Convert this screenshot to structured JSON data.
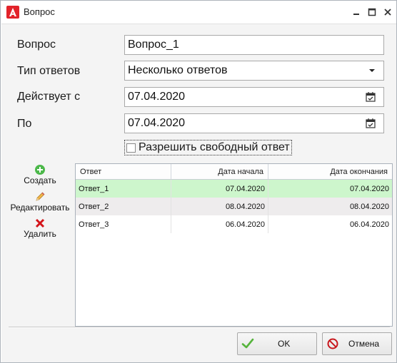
{
  "window": {
    "title": "Вопрос",
    "icon": "app-logo-icon"
  },
  "form": {
    "question_label": "Вопрос",
    "question_value": "Вопрос_1",
    "answer_type_label": "Тип ответов",
    "answer_type_value": "Несколько ответов",
    "valid_from_label": "Действует с",
    "valid_from_value": "07.04.2020",
    "valid_to_label": "По",
    "valid_to_value": "07.04.2020",
    "free_answer_label": "Разрешить свободный ответ",
    "free_answer_checked": false
  },
  "side_toolbar": {
    "create_label": "Создать",
    "edit_label": "Редактировать",
    "delete_label": "Удалить"
  },
  "grid": {
    "columns": [
      "Ответ",
      "Дата начала",
      "Дата окончания"
    ],
    "rows": [
      [
        "Ответ_1",
        "07.04.2020",
        "07.04.2020"
      ],
      [
        "Ответ_2",
        "08.04.2020",
        "08.04.2020"
      ],
      [
        "Ответ_3",
        "06.04.2020",
        "06.04.2020"
      ]
    ],
    "selected_row_color": "#cdf6cc"
  },
  "buttons": {
    "ok_label": "OK",
    "cancel_label": "Отмена"
  }
}
